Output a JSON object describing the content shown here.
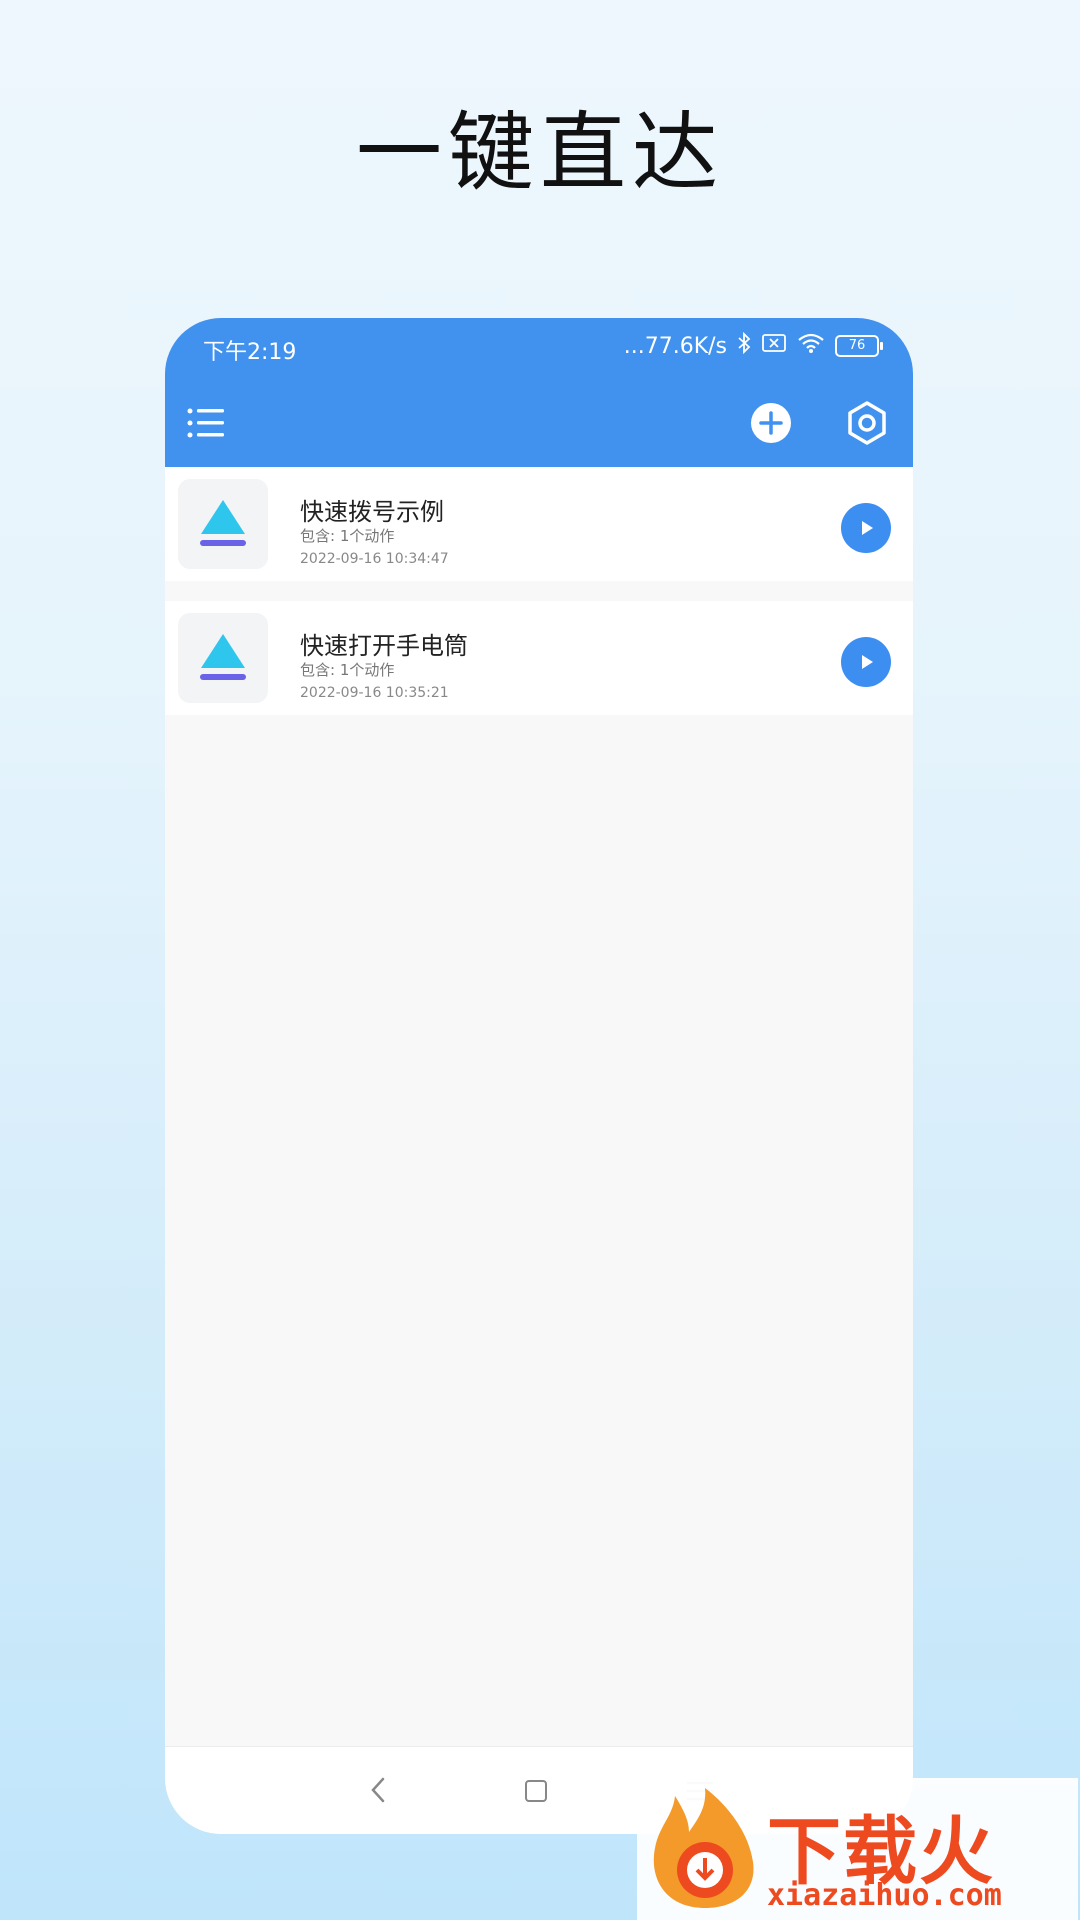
{
  "promo": {
    "title": "一键直达"
  },
  "status_bar": {
    "time": "下午2:19",
    "net_speed": "...77.6K/s",
    "battery": "76"
  },
  "toolbar": {
    "menu_icon": "list-menu-icon",
    "add_icon": "plus-circle-icon",
    "settings_icon": "hexagon-settings-icon",
    "accent": "#4192ee"
  },
  "shortcuts": [
    {
      "title": "快速拨号示例",
      "subtitle": "包含: 1个动作",
      "date": "2022-09-16 10:34:47"
    },
    {
      "title": "快速打开手电筒",
      "subtitle": "包含: 1个动作",
      "date": "2022-09-16 10:35:21"
    }
  ],
  "watermark": {
    "brand": "下载火",
    "url": "xiazaihuo.com",
    "color": "#ee4a20"
  }
}
